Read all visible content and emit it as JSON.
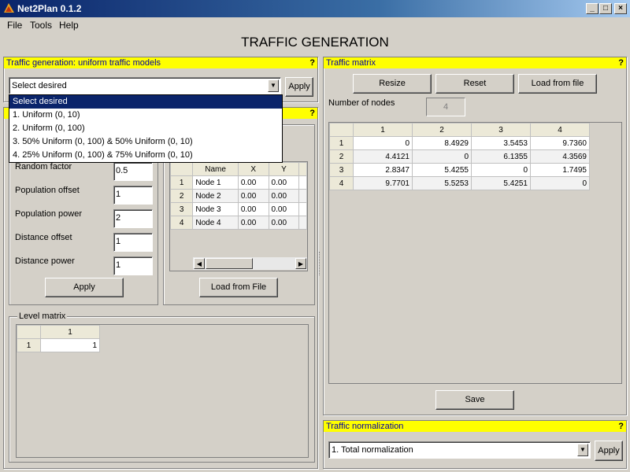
{
  "window": {
    "title": "Net2Plan 0.1.2",
    "min": "_",
    "max": "□",
    "close": "×"
  },
  "menu": {
    "file": "File",
    "tools": "Tools",
    "help": "Help"
  },
  "page_title": "TRAFFIC GENERATION",
  "help_mark": "?",
  "uniform": {
    "header": "Traffic generation: uniform traffic models",
    "combo_value": "Select desired",
    "apply": "Apply",
    "options": [
      "Select desired",
      "1. Uniform (0, 10)",
      "2. Uniform (0, 100)",
      "3. 50% Uniform (0, 100) & 50% Uniform (0, 10)",
      "4. 25% Uniform (0, 100) & 75% Uniform (0, 10)"
    ]
  },
  "gravity": {
    "params": [
      {
        "label": "Random factor",
        "value": "0.5"
      },
      {
        "label": "Population offset",
        "value": "1"
      },
      {
        "label": "Population power",
        "value": "2"
      },
      {
        "label": "Distance offset",
        "value": "1"
      },
      {
        "label": "Distance power",
        "value": "1"
      }
    ],
    "apply": "Apply",
    "load": "Load from File",
    "node_table": {
      "headers": [
        "Name",
        "X",
        "Y"
      ],
      "rows": [
        {
          "id": "1",
          "name": "Node 1",
          "x": "0.00",
          "y": "0.00"
        },
        {
          "id": "2",
          "name": "Node 2",
          "x": "0.00",
          "y": "0.00"
        },
        {
          "id": "3",
          "name": "Node 3",
          "x": "0.00",
          "y": "0.00"
        },
        {
          "id": "4",
          "name": "Node 4",
          "x": "0.00",
          "y": "0.00"
        }
      ]
    }
  },
  "level": {
    "title": "Level matrix",
    "col": "1",
    "row": "1",
    "value": "1"
  },
  "traffic": {
    "header": "Traffic matrix",
    "resize": "Resize",
    "reset": "Reset",
    "load": "Load from file",
    "nodes_label": "Number of nodes",
    "nodes_value": "4",
    "cols": [
      "1",
      "2",
      "3",
      "4"
    ],
    "rows": [
      {
        "id": "1",
        "vals": [
          "0",
          "8.4929",
          "3.5453",
          "9.7360"
        ]
      },
      {
        "id": "2",
        "vals": [
          "4.4121",
          "0",
          "6.1355",
          "4.3569"
        ]
      },
      {
        "id": "3",
        "vals": [
          "2.8347",
          "5.4255",
          "0",
          "1.7495"
        ]
      },
      {
        "id": "4",
        "vals": [
          "9.7701",
          "5.5253",
          "5.4251",
          "0"
        ]
      }
    ],
    "save": "Save"
  },
  "normalization": {
    "header": "Traffic normalization",
    "combo_value": "1. Total normalization",
    "apply": "Apply"
  }
}
